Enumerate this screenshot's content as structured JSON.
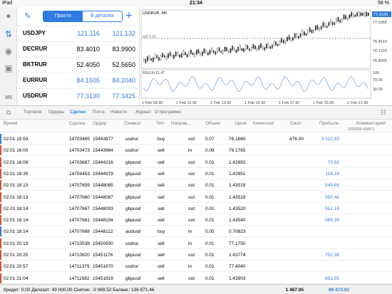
{
  "status": {
    "device": "iPad",
    "time": "21:34",
    "battery": "58 %"
  },
  "side": {
    "icons": [
      "user-icon",
      "trade-icon",
      "chat-icon",
      "new-doc-icon",
      "ms-icon"
    ],
    "ms_label": "M5"
  },
  "quotes": {
    "tab_simple": "Просто",
    "tab_detail": "В деталях",
    "rows": [
      {
        "symbol": "USDJPY",
        "bid": "121.116",
        "ask": "121.132"
      },
      {
        "symbol": "DECRUR",
        "bid": "83.4010",
        "ask": "83.9900"
      },
      {
        "symbol": "BKTRUR",
        "bid": "52.4050",
        "ask": "52.5650"
      },
      {
        "symbol": "EURRUR",
        "bid": "84.1505",
        "ask": "84.2040"
      },
      {
        "symbol": "USDRUR",
        "bid": "77.3130",
        "ask": "77.3425"
      }
    ]
  },
  "chart": {
    "title": "USDRUR, M5",
    "sell_label": "sell 0.10",
    "price_tag": "77.3130",
    "ylabels": [
      "77.0365",
      "76.4510",
      "76.1220",
      "75.8005"
    ],
    "rsi_label": "RSI(14) 61.47",
    "rsi_levels": [
      "100",
      "70.00",
      "30.00"
    ],
    "xlabels": [
      "1 Feb 09:30",
      "1 Feb 11:30",
      "1 Feb 13:30",
      "1 Feb 15:30",
      "1 Feb 17:30",
      "1 Feb 19:30",
      "1 Feb 21:30"
    ]
  },
  "tabs": [
    "Торговля",
    "Ордеры",
    "Сделки",
    "Почта",
    "Новости",
    "Журнал",
    "О программе"
  ],
  "active_tab": "Сделки",
  "columns": [
    "Время",
    "Сделка",
    "Ордер",
    "Символ",
    "Тип",
    "Направ...",
    "Объем",
    "Цена",
    "Комиссия",
    "Своп",
    "Прибыль",
    "Комментарий"
  ],
  "top_comment": "1000000-000071",
  "trades": [
    {
      "time": "02.01 15:59",
      "deal": "14703465",
      "order": "15443877",
      "symbol": "usdrur",
      "type": "buy",
      "dir": "out",
      "vol": "0.07",
      "price": "76.1860",
      "swap": "476.00",
      "profit": "3 022.43",
      "pc": "#2f7be0",
      "bar": "#2f7be0"
    },
    {
      "time": "02.01 16:00",
      "deal": "14703473",
      "order": "15443984",
      "symbol": "usdrur",
      "type": "sell",
      "dir": "in",
      "vol": "0.08",
      "price": "76.1765",
      "swap": "",
      "profit": "",
      "pc": "#2f7be0",
      "bar": "#e05030"
    },
    {
      "time": "02.01 16:08",
      "deal": "14703687",
      "order": "15444216",
      "symbol": "gbpusd",
      "type": "sell",
      "dir": "out",
      "vol": "0.01",
      "price": "1.42892",
      "swap": "",
      "profit": "70.92",
      "pc": "#2f7be0",
      "bar": "#e05030"
    },
    {
      "time": "02.01 16:35",
      "deal": "14704453",
      "order": "15444979",
      "symbol": "gbpusd",
      "type": "sell",
      "dir": "out",
      "vol": "0.01",
      "price": "1.42951",
      "swap": "",
      "profit": "116.24",
      "pc": "#2f7be0",
      "bar": "#e05030"
    },
    {
      "time": "02.01 18:13",
      "deal": "14707659",
      "order": "15448085",
      "symbol": "gbpusd",
      "type": "sell",
      "dir": "out",
      "vol": "0.01",
      "price": "1.43518",
      "swap": "",
      "profit": "549.65",
      "pc": "#2f7be0",
      "bar": "#e05030"
    },
    {
      "time": "02.01 18:13",
      "deal": "14707660",
      "order": "15448087",
      "symbol": "gbpusd",
      "type": "sell",
      "dir": "out",
      "vol": "0.01",
      "price": "1.43519",
      "swap": "",
      "profit": "550.44",
      "pc": "#2f7be0",
      "bar": "#e05030"
    },
    {
      "time": "02.01 18:14",
      "deal": "14707667",
      "order": "15448093",
      "symbol": "gbpusd",
      "type": "sell",
      "dir": "out",
      "vol": "0.01",
      "price": "1.43520",
      "swap": "",
      "profit": "551.16",
      "pc": "#2f7be0",
      "bar": "#e05030"
    },
    {
      "time": "02.01 18:14",
      "deal": "14707681",
      "order": "15448104",
      "symbol": "gbpusd",
      "type": "sell",
      "dir": "out",
      "vol": "0.01",
      "price": "1.43540",
      "swap": "",
      "profit": "565.39",
      "pc": "#2f7be0",
      "bar": "#e05030"
    },
    {
      "time": "02.01 18:14",
      "deal": "14707688",
      "order": "15448112",
      "symbol": "audusd",
      "type": "buy",
      "dir": "in",
      "vol": "0.05",
      "price": "0.70823",
      "swap": "",
      "profit": "",
      "pc": "#2f7be0",
      "bar": "#2f7be0"
    },
    {
      "time": "02.01 20:19",
      "deal": "14710539",
      "order": "15450930",
      "symbol": "usdrur",
      "type": "sell",
      "dir": "in",
      "vol": "0.01",
      "price": "77.1750",
      "swap": "",
      "profit": "",
      "pc": "#2f7be0",
      "bar": "#e05030"
    },
    {
      "time": "02.01 20:25",
      "deal": "14710820",
      "order": "15451176",
      "symbol": "gbpusd",
      "type": "sell",
      "dir": "out",
      "vol": "0.01",
      "price": "1.43774",
      "swap": "",
      "profit": "752.38",
      "pc": "#2f7be0",
      "bar": "#e05030"
    },
    {
      "time": "02.01 20:57",
      "deal": "14711379",
      "order": "15451670",
      "symbol": "usdrur",
      "type": "sell",
      "dir": "in",
      "vol": "0.01",
      "price": "77.4040",
      "swap": "",
      "profit": "",
      "pc": "#2f7be0",
      "bar": "#e05030"
    },
    {
      "time": "02.01 21:04",
      "deal": "14711582",
      "order": "15451819",
      "symbol": "gbpusd",
      "type": "sell",
      "dir": "out",
      "vol": "0.01",
      "price": "1.43903",
      "swap": "",
      "profit": "853.05",
      "pc": "#2f7be0",
      "bar": "#e05030"
    }
  ],
  "footer": {
    "summary": "Кредит: 0.00 Депозит: 49 000.00 Снятие: -3 069.52 Баланс: 136 871.46",
    "swap": "1 467.05",
    "profit": "89 473.93"
  }
}
